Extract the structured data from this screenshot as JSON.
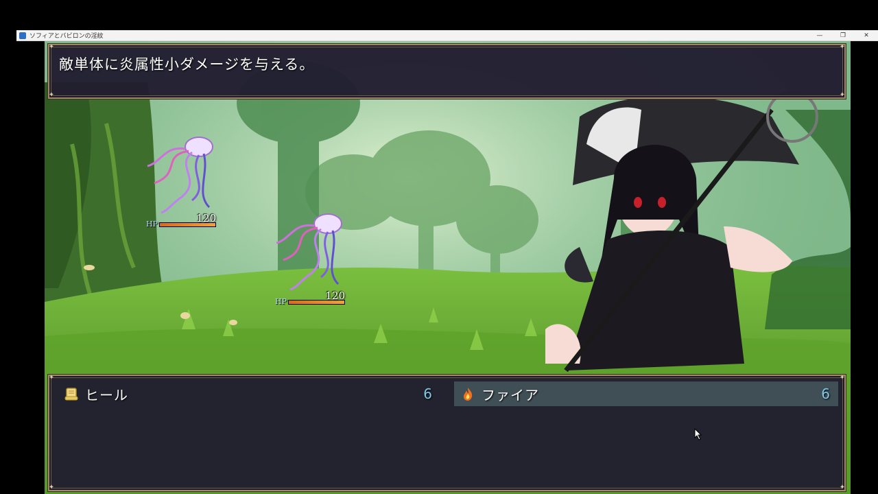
{
  "window": {
    "title": "ソフィアとバビロンの淫紋",
    "minimize": "—",
    "maximize": "❐",
    "close": "✕"
  },
  "help": {
    "text": "敵単体に炎属性小ダメージを与える。"
  },
  "enemies": [
    {
      "name": "jellyfish-enemy-1",
      "hp_label": "HP",
      "hp": "120",
      "hp_fraction": 1.0
    },
    {
      "name": "jellyfish-enemy-2",
      "hp_label": "HP",
      "hp": "120",
      "hp_fraction": 1.0
    }
  ],
  "skills": [
    {
      "label": "ヒール",
      "cost": "6",
      "icon": "scroll-icon",
      "selected": false
    },
    {
      "label": "ファイア",
      "cost": "6",
      "icon": "fire-icon",
      "selected": true
    }
  ],
  "colors": {
    "panel_bg": "#211d30",
    "panel_border": "#a08a6a",
    "cost_text": "#7fc8e8",
    "hp_fill": "#e0802c"
  }
}
